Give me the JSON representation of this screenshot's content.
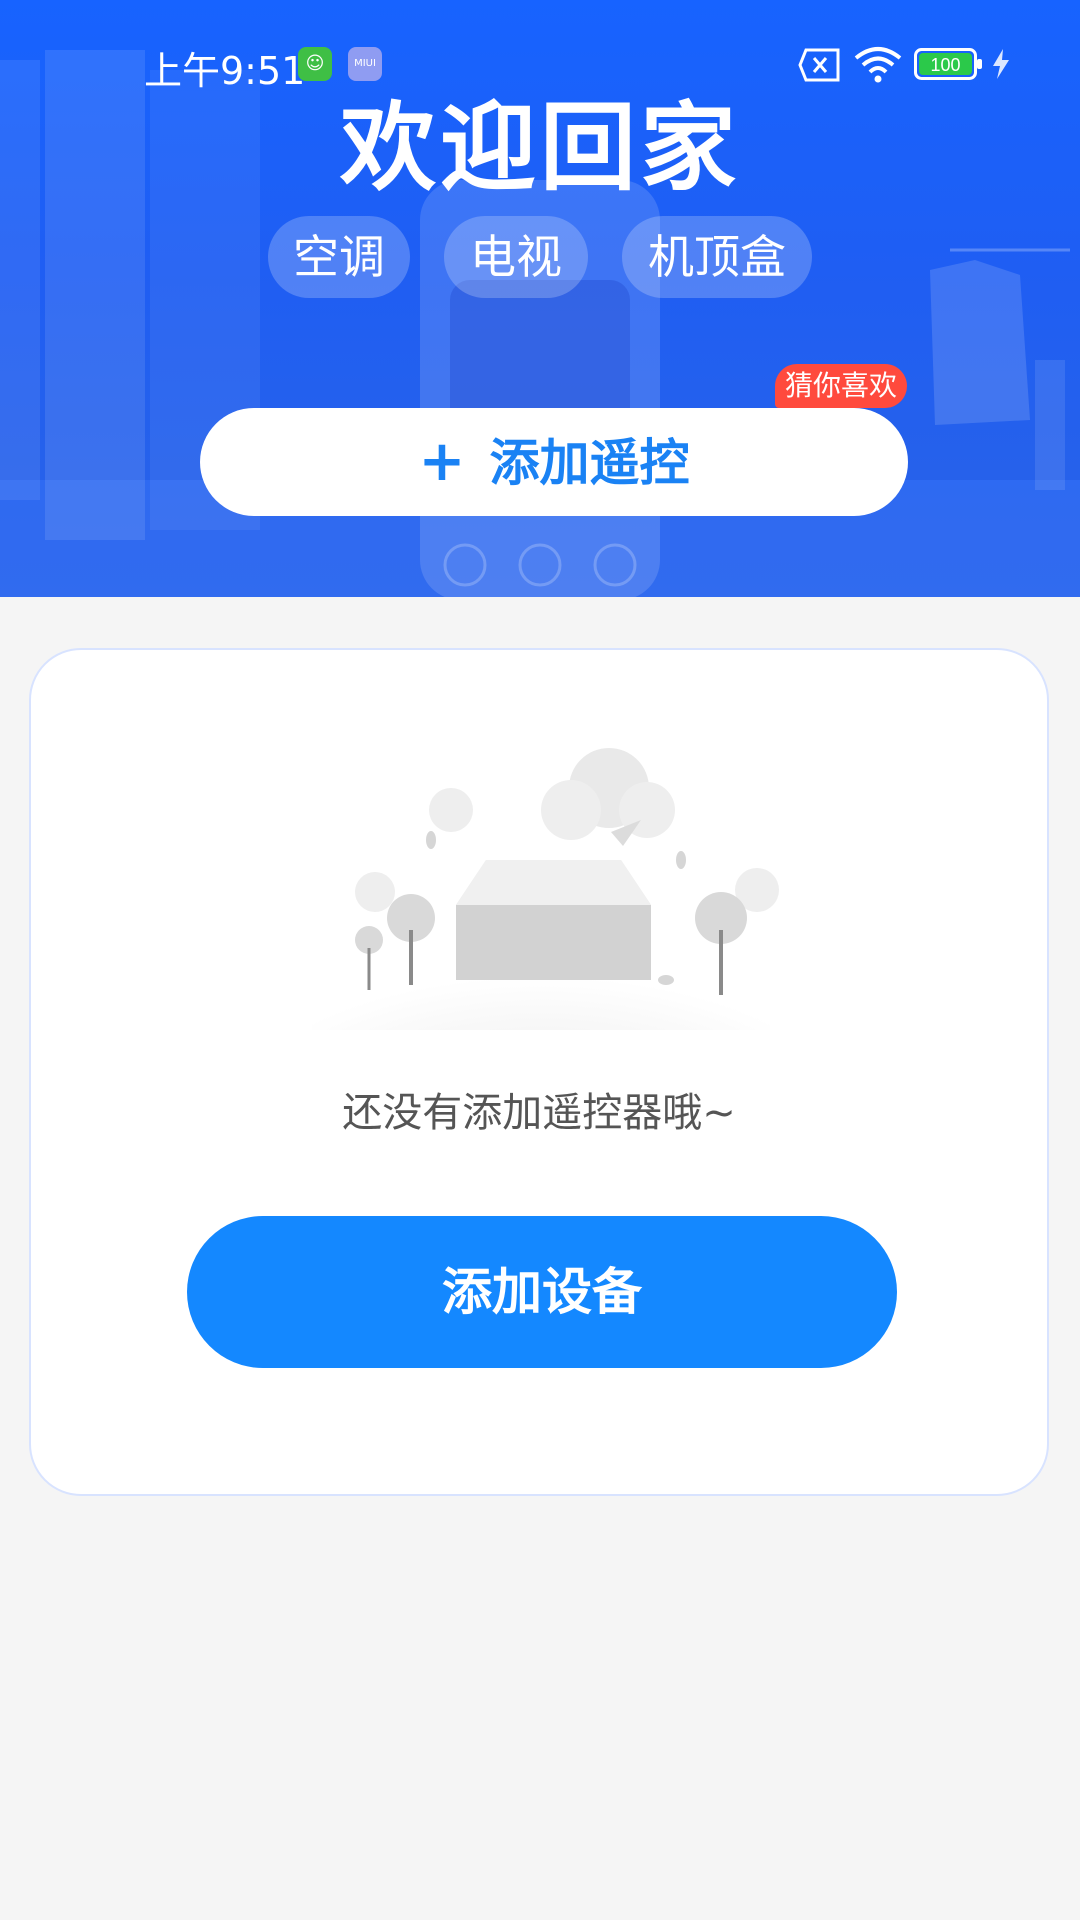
{
  "status_bar": {
    "time": "上午9:51",
    "app_icon_2_label": "MIUI",
    "battery": "100"
  },
  "hero": {
    "title": "欢迎回家",
    "chips": [
      "空调",
      "电视",
      "机顶盒"
    ],
    "add_remote_label": "添加遥控",
    "badge": "猜你喜欢",
    "accent_color": "#1a82f4",
    "badge_color": "#ff4a3d"
  },
  "empty_state": {
    "message": "还没有添加遥控器哦~",
    "add_device_label": "添加设备",
    "button_color": "#1488ff"
  }
}
